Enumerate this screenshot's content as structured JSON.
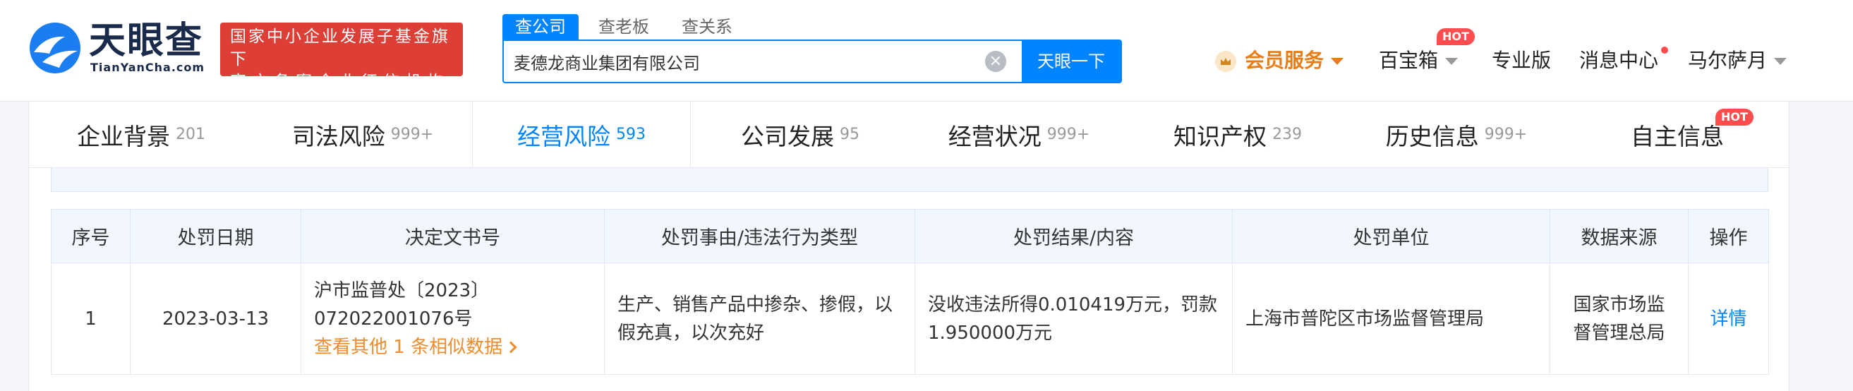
{
  "header": {
    "logo_cn": "天眼查",
    "logo_en": "TianYanCha.com",
    "slogan_line1": "国家中小企业发展子基金旗下",
    "slogan_line2": "官方备案企业征信机构",
    "search_tabs": [
      "查公司",
      "查老板",
      "查关系"
    ],
    "search_value": "麦德龙商业集团有限公司",
    "search_button": "天眼一下",
    "nav": {
      "vip": "会员服务",
      "toolbox": "百宝箱",
      "toolbox_badge": "HOT",
      "pro": "专业版",
      "messages": "消息中心",
      "user": "马尔萨月"
    },
    "colors": {
      "brand": "#0084ff",
      "slogan_bg": "#dd3e35",
      "vip": "#e97c12",
      "hot": "#ff4d4f"
    }
  },
  "tabs": [
    {
      "label": "企业背景",
      "count": "201"
    },
    {
      "label": "司法风险",
      "count": "999+"
    },
    {
      "label": "经营风险",
      "count": "593"
    },
    {
      "label": "公司发展",
      "count": "95"
    },
    {
      "label": "经营状况",
      "count": "999+"
    },
    {
      "label": "知识产权",
      "count": "239"
    },
    {
      "label": "历史信息",
      "count": "999+"
    },
    {
      "label": "自主信息",
      "count": ""
    }
  ],
  "tab_hot_badge": "HOT",
  "table": {
    "headers": [
      "序号",
      "处罚日期",
      "决定文书号",
      "处罚事由/违法行为类型",
      "处罚结果/内容",
      "处罚单位",
      "数据来源",
      "操作"
    ],
    "rows": [
      {
        "index": "1",
        "date": "2023-03-13",
        "doc_no_line1": "沪市监普处〔2023〕",
        "doc_no_line2": "072022001076号",
        "similar_link": "查看其他 1 条相似数据",
        "reason": "生产、销售产品中掺杂、掺假，以假充真，以次充好",
        "result": "没收违法所得0.010419万元，罚款1.950000万元",
        "authority": "上海市普陀区市场监督管理局",
        "source": "国家市场监督管理总局",
        "action": "详情"
      }
    ]
  }
}
